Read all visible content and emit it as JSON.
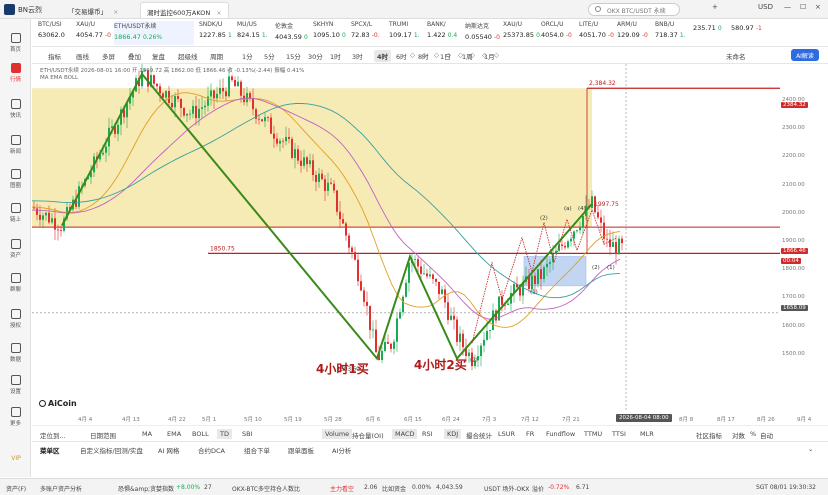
{
  "app": {
    "title": "BN云烈"
  },
  "tabs": [
    {
      "label": "「交易爆币」",
      "active": false
    },
    {
      "label": "潮时监控600万AKON",
      "active": true
    }
  ],
  "search": {
    "placeholder": "OKX BTC/USDT 永续"
  },
  "window_right": {
    "plus": "+",
    "currency": "USD"
  },
  "sidebar": [
    {
      "label": "首页",
      "icon": "home-icon"
    },
    {
      "label": "行情",
      "icon": "market-icon",
      "active": true
    },
    {
      "label": "快讯",
      "icon": "news-icon"
    },
    {
      "label": "新闻",
      "icon": "article-icon"
    },
    {
      "label": "图圈",
      "icon": "community-icon"
    },
    {
      "label": "链上",
      "icon": "chain-icon"
    },
    {
      "label": "资产",
      "icon": "wallet-icon"
    },
    {
      "label": "群聊",
      "icon": "chat-icon"
    },
    {
      "label": "授权",
      "icon": "key-icon"
    },
    {
      "label": "数据",
      "icon": "data-icon"
    },
    {
      "label": "设置",
      "icon": "settings-icon"
    },
    {
      "label": "更多",
      "icon": "more-icon"
    }
  ],
  "vip": "VIP",
  "tickers": [
    {
      "name": "BTC/USI",
      "price": "63062.0",
      "change": ""
    },
    {
      "name": "XAU/U",
      "price": "4054.77",
      "change": "-0"
    },
    {
      "name": "ETH/USDT永续",
      "price": "1866.47",
      "change": "0.26%",
      "active": true
    },
    {
      "name": "SNDK/U",
      "price": "1227.85",
      "change": "1"
    },
    {
      "name": "MU/US",
      "price": "824.15",
      "change": "1."
    },
    {
      "name": "伦敦金",
      "price": "4043.59",
      "change": "0"
    },
    {
      "name": "SKHYN",
      "price": "1095.10",
      "change": "0"
    },
    {
      "name": "SPCX/L",
      "price": "72.83",
      "change": "-0."
    },
    {
      "name": "TRUMI",
      "price": "109.17",
      "change": "1."
    },
    {
      "name": "BANK/",
      "price": "1.422",
      "change": "0.4"
    },
    {
      "name": "纳斯达克",
      "price": "0.05540",
      "change": "-0"
    },
    {
      "name": "XAU/U",
      "price": "25373.85",
      "change": "0."
    },
    {
      "name": "ORCL/U",
      "price": "4054.0",
      "change": "-0"
    },
    {
      "name": "LITE/U",
      "price": "4051.70",
      "change": "-0"
    },
    {
      "name": "ARM/U",
      "price": "129.09",
      "change": "-0"
    },
    {
      "name": "BNB/U",
      "price": "718.37",
      "change": "1."
    },
    {
      "name": "",
      "price": "235.71",
      "change": "0"
    },
    {
      "name": "",
      "price": "580.97",
      "change": "-1"
    }
  ],
  "toolbar": {
    "items": [
      "指标",
      "画线",
      "多屏",
      "叠加",
      "复盘",
      "超级线"
    ],
    "period_label": "周期",
    "periods": [
      "1分",
      "5分",
      "15分",
      "30分",
      "1时",
      "3时",
      "4时",
      "6时",
      "8时",
      "1日",
      "1周",
      "1月"
    ],
    "selected_period": "4时",
    "right_label": "未命名",
    "ai_button": "AI解读"
  },
  "chart_header": {
    "line1": "ETH/USDT永续 2026-08-01 16:00 开 1869.72 高 1862.00 低 1866.46 收 -0.13%(-2.44) 振幅 0.41%",
    "line2": "MA EMA BOLL"
  },
  "chart_annotations": {
    "buy1": "4小时1买",
    "buy2": "4小时2买",
    "low_label": "1503.60",
    "top_label": "2,384.32",
    "level_1850": "1850.75",
    "level_1997": "1997.75",
    "wave_labels": [
      "(2)",
      "(1)",
      "(2)",
      "(4)",
      "(a)",
      "(2)",
      "(1)"
    ]
  },
  "watermark": "AiCoin",
  "y_axis": {
    "labels": [
      "2400.00",
      "2300.00",
      "2200.00",
      "2100.00",
      "2000.00",
      "1900.00",
      "1800.00",
      "1700.00",
      "1600.00",
      "1500.00"
    ],
    "badges": [
      {
        "text": "2384.32",
        "color": "#d02a2a"
      },
      {
        "text": "1866.46",
        "color": "#d02a2a"
      },
      {
        "text": "00:04",
        "color": "#d02a2a"
      },
      {
        "text": "1658.09",
        "color": "#555555"
      }
    ]
  },
  "x_axis": {
    "labels": [
      "4月 4",
      "4月 13",
      "4月 22",
      "5月 1",
      "5月 10",
      "5月 19",
      "5月 28",
      "6月 6",
      "6月 15",
      "6月 24",
      "7月 3",
      "7月 12",
      "7月 21",
      "8月 8",
      "8月 17",
      "8月 26",
      "9月 4"
    ],
    "cursor_badge": "2026-08-04 08:00"
  },
  "indicator_row": {
    "left": [
      "定位到...",
      "日期范围"
    ],
    "main": [
      "MA",
      "EMA",
      "BOLL",
      "TD",
      "SBI"
    ],
    "selected_main": "TD",
    "sub": [
      "Volume",
      "持仓量(OI)",
      "MACD",
      "RSI",
      "KDJ",
      "撮合统计",
      "LSUR",
      "FR",
      "Fundflow",
      "TTMU",
      "TTSI",
      "MLR"
    ],
    "selected_sub": [
      "Volume",
      "MACD",
      "KDJ"
    ],
    "periods": [
      "1分",
      "5分",
      "15分",
      "30分",
      "1时",
      "4时",
      "1日",
      "1周",
      "1月"
    ],
    "selected_period": "4时",
    "right": [
      "社区指标",
      "对数",
      "%",
      "自动"
    ]
  },
  "bottom_tabs": [
    "菜单区",
    "自定义指标/回测/实盘",
    "AI 网格",
    "合约DCA",
    "组合下单",
    "跟单面板",
    "AI分析"
  ],
  "status_bar": {
    "items": [
      {
        "text": "资产(F)",
        "color": ""
      },
      {
        "text": "多账户资产分析",
        "color": ""
      },
      {
        "text": "恐惧&amp;贪婪指数",
        "color": ""
      },
      {
        "text": "+8.00%",
        "color": "#1aaa55"
      },
      {
        "text": "27",
        "color": ""
      },
      {
        "text": "OKX-BTC多空持仓人数比",
        "color": ""
      },
      {
        "text": "主力看空",
        "color": "#e03030"
      },
      {
        "text": "2.06",
        "color": ""
      },
      {
        "text": "比如资金",
        "color": ""
      },
      {
        "text": "0.00%",
        "color": ""
      },
      {
        "text": "4,043.59",
        "color": ""
      },
      {
        "text": "USDT 场外-OKX",
        "color": ""
      },
      {
        "text": "溢价",
        "color": ""
      },
      {
        "text": "-0.72%",
        "color": "#e03030"
      },
      {
        "text": "6.71",
        "color": ""
      },
      {
        "text": "SGT 08/01 19:30:32",
        "color": ""
      }
    ]
  },
  "colors": {
    "accent": "#2c6be0",
    "up": "#1aaa55",
    "down": "#e03030",
    "zone": "#f5e6a8"
  }
}
